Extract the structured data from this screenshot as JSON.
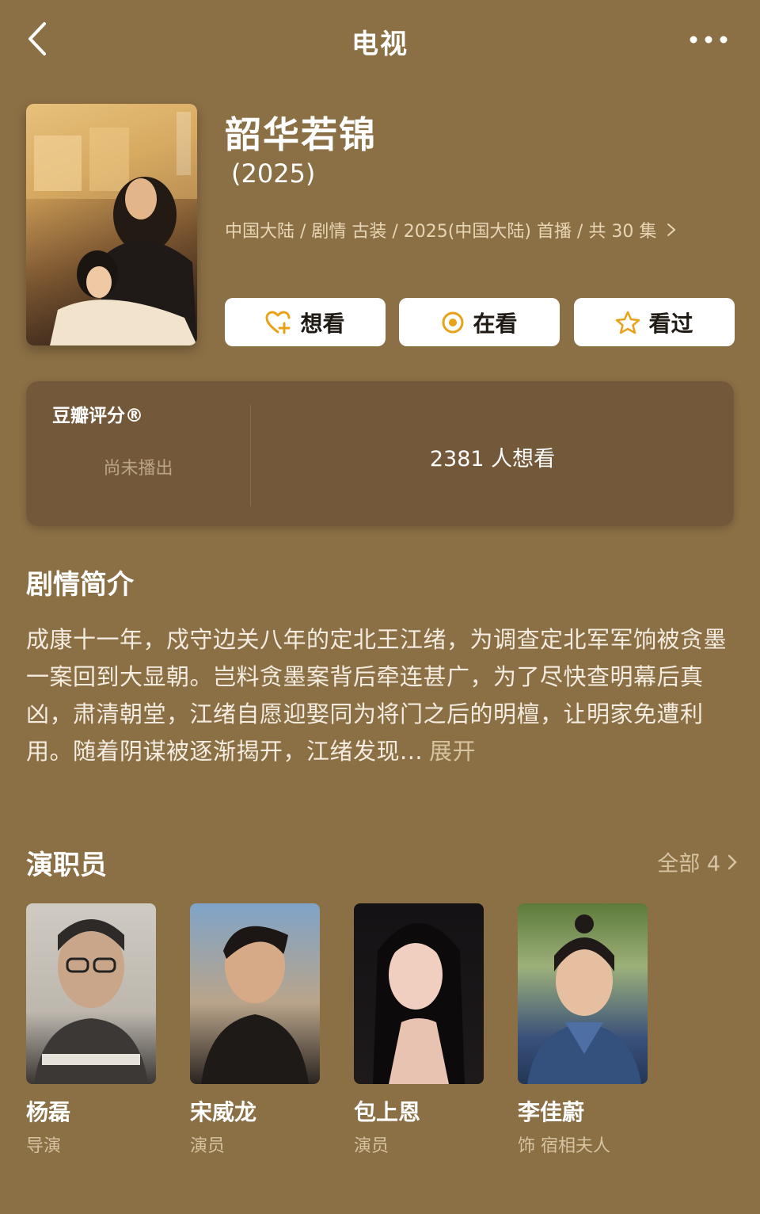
{
  "header": {
    "title": "电视"
  },
  "show": {
    "title": "韶华若锦",
    "year": "(2025)",
    "meta": "中国大陆 / 剧情 古装 / 2025(中国大陆) 首播 / 共 30 集"
  },
  "actions": {
    "want": "想看",
    "watching": "在看",
    "watched": "看过"
  },
  "rating": {
    "label": "豆瓣评分®",
    "status": "尚未播出",
    "want_count": "2381 人想看"
  },
  "synopsis": {
    "title": "剧情简介",
    "text": "成康十一年，戍守边关八年的定北王江绪，为调查定北军军饷被贪墨一案回到大显朝。岂料贪墨案背后牵连甚广，为了尽快查明幕后真凶，肃清朝堂，江绪自愿迎娶同为将门之后的明檀，让明家免遭利用。随着阴谋被逐渐揭开，江绪发现...",
    "expand": "展开"
  },
  "cast": {
    "title": "演职员",
    "all_label": "全部 4",
    "members": [
      {
        "name": "杨磊",
        "role": "导演"
      },
      {
        "name": "宋威龙",
        "role": "演员"
      },
      {
        "name": "包上恩",
        "role": "演员"
      },
      {
        "name": "李佳蔚",
        "role": "饰 宿相夫人"
      }
    ]
  },
  "colors": {
    "background": "#8b6f45",
    "card": "#73593a",
    "accent": "#e8a21a"
  }
}
